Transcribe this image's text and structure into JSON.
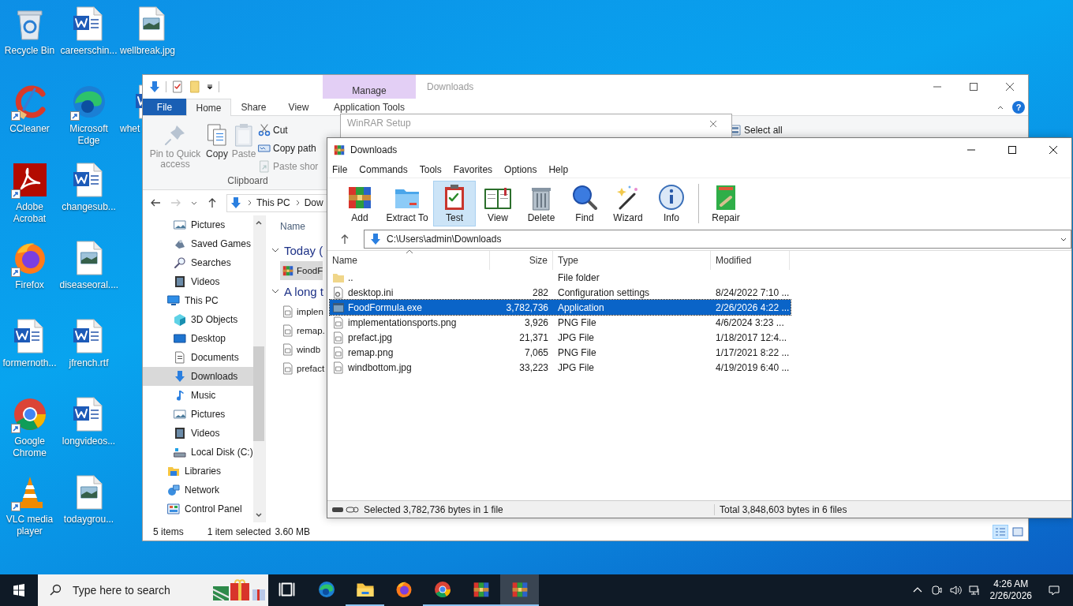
{
  "desktop_columns": [
    [
      {
        "label": "Recycle Bin",
        "kind": "recycle",
        "shortcut": false
      },
      {
        "label": "CCleaner",
        "kind": "ccleaner",
        "shortcut": true
      },
      {
        "label": "Adobe Acrobat",
        "kind": "acrobat",
        "shortcut": true
      },
      {
        "label": "Firefox",
        "kind": "firefox",
        "shortcut": true
      },
      {
        "label": "formernoth...",
        "kind": "word",
        "shortcut": false
      },
      {
        "label": "Google Chrome",
        "kind": "chrome",
        "shortcut": true
      },
      {
        "label": "VLC media player",
        "kind": "vlc",
        "shortcut": true
      }
    ],
    [
      {
        "label": "careerschin...",
        "kind": "word",
        "shortcut": false
      },
      {
        "label": "Microsoft Edge",
        "kind": "edge",
        "shortcut": true
      },
      {
        "label": "changesub...",
        "kind": "word",
        "shortcut": false
      },
      {
        "label": "diseaseoral....",
        "kind": "image",
        "shortcut": false
      },
      {
        "label": "jfrench.rtf",
        "kind": "word",
        "shortcut": false
      },
      {
        "label": "longvideos...",
        "kind": "word",
        "shortcut": false
      },
      {
        "label": "todaygrou...",
        "kind": "image",
        "shortcut": false
      }
    ],
    [
      {
        "label": "wellbreak.jpg",
        "kind": "image",
        "shortcut": false
      },
      {
        "label": "whet",
        "kind": "word",
        "shortcut": false
      }
    ]
  ],
  "explorer": {
    "title": "Downloads",
    "context_tab": "Manage",
    "help": "?",
    "tabs": [
      {
        "label": "File",
        "kind": "file",
        "selected": false
      },
      {
        "label": "Home",
        "kind": "tab",
        "selected": true
      },
      {
        "label": "Share",
        "kind": "tab",
        "selected": false
      },
      {
        "label": "View",
        "kind": "tab",
        "selected": false
      },
      {
        "label": "Application Tools",
        "kind": "tab",
        "selected": false
      }
    ],
    "ribbon": {
      "large": [
        {
          "label": "Pin to Quick access",
          "kind": "pin",
          "disabled": true
        },
        {
          "label": "Copy",
          "kind": "copy",
          "disabled": false
        },
        {
          "label": "Paste",
          "kind": "paste",
          "disabled": true
        }
      ],
      "small": [
        {
          "label": "Cut",
          "kind": "cut",
          "disabled": false
        },
        {
          "label": "Copy path",
          "kind": "copypath",
          "disabled": false
        },
        {
          "label": "Paste shor",
          "kind": "shortcut",
          "disabled": true
        }
      ],
      "group": "Clipboard",
      "select_all": "Select all"
    },
    "path": [
      "This PC",
      "Dow"
    ],
    "nav_partial": [
      {
        "label": "Pictures",
        "kind": "pictures",
        "selected": false
      },
      {
        "label": "Saved Games",
        "kind": "games",
        "selected": false
      },
      {
        "label": "Searches",
        "kind": "search",
        "selected": false
      },
      {
        "label": "Videos",
        "kind": "videos",
        "selected": false
      }
    ],
    "nav": [
      {
        "label": "This PC",
        "kind": "pc",
        "selected": false,
        "children": [
          {
            "label": "3D Objects",
            "kind": "cube",
            "selected": false
          },
          {
            "label": "Desktop",
            "kind": "desktop",
            "selected": false
          },
          {
            "label": "Documents",
            "kind": "documents",
            "selected": false
          },
          {
            "label": "Downloads",
            "kind": "downloads",
            "selected": true
          },
          {
            "label": "Music",
            "kind": "music",
            "selected": false
          },
          {
            "label": "Pictures",
            "kind": "pictures",
            "selected": false
          },
          {
            "label": "Videos",
            "kind": "videos",
            "selected": false
          },
          {
            "label": "Local Disk (C:)",
            "kind": "disk",
            "selected": false
          }
        ]
      },
      {
        "label": "Libraries",
        "kind": "libraries",
        "selected": false
      },
      {
        "label": "Network",
        "kind": "network",
        "selected": false
      },
      {
        "label": "Control Panel",
        "kind": "control",
        "selected": false
      }
    ],
    "column": "Name",
    "groups": [
      {
        "label": "Today (",
        "expanded": true,
        "files": [
          {
            "name": "FoodF",
            "kind": "rar",
            "selected": true
          }
        ]
      },
      {
        "label": "A long t",
        "expanded": true,
        "files": [
          {
            "name": "implen",
            "kind": "file",
            "selected": false
          },
          {
            "name": "remap.",
            "kind": "file",
            "selected": false
          },
          {
            "name": "windb",
            "kind": "file",
            "selected": false
          },
          {
            "name": "prefact",
            "kind": "file",
            "selected": false
          }
        ]
      }
    ],
    "status": {
      "count": "5 items",
      "selection": "1 item selected",
      "size": "3.60 MB"
    }
  },
  "setup_window": {
    "title": "WinRAR Setup"
  },
  "winrar": {
    "title": "Downloads",
    "menu": [
      "File",
      "Commands",
      "Tools",
      "Favorites",
      "Options",
      "Help"
    ],
    "tools": [
      {
        "label": "Add",
        "kind": "rar",
        "selected": false
      },
      {
        "label": "Extract To",
        "kind": "extract",
        "selected": false
      },
      {
        "label": "Test",
        "kind": "test",
        "selected": true
      },
      {
        "label": "View",
        "kind": "view",
        "selected": false
      },
      {
        "label": "Delete",
        "kind": "delete",
        "selected": false
      },
      {
        "label": "Find",
        "kind": "find",
        "selected": false
      },
      {
        "label": "Wizard",
        "kind": "wizard",
        "selected": false
      },
      {
        "label": "Info",
        "kind": "info",
        "selected": false
      },
      {
        "label": "Repair",
        "kind": "repair",
        "selected": false
      }
    ],
    "path": "C:\\Users\\admin\\Downloads",
    "columns": [
      "Name",
      "Size",
      "Type",
      "Modified"
    ],
    "rows": [
      {
        "name": "..",
        "size": "",
        "type": "File folder",
        "modified": "",
        "kind": "folder",
        "selected": false
      },
      {
        "name": "desktop.ini",
        "size": "282",
        "type": "Configuration settings",
        "modified": "8/24/2022 7:10 ...",
        "kind": "ini",
        "selected": false
      },
      {
        "name": "FoodFormula.exe",
        "size": "3,782,736",
        "type": "Application",
        "modified": "2/26/2026 4:22 ...",
        "kind": "exe",
        "selected": true
      },
      {
        "name": "implementationsports.png",
        "size": "3,926",
        "type": "PNG File",
        "modified": "4/6/2024 3:23 ...",
        "kind": "file",
        "selected": false
      },
      {
        "name": "prefact.jpg",
        "size": "21,371",
        "type": "JPG File",
        "modified": "1/18/2017 12:4...",
        "kind": "file",
        "selected": false
      },
      {
        "name": "remap.png",
        "size": "7,065",
        "type": "PNG File",
        "modified": "1/17/2021 8:22 ...",
        "kind": "file",
        "selected": false
      },
      {
        "name": "windbottom.jpg",
        "size": "33,223",
        "type": "JPG File",
        "modified": "4/19/2019 6:40 ...",
        "kind": "file",
        "selected": false
      }
    ],
    "status": [
      "Selected 3,782,736 bytes in 1 file",
      "Total 3,848,603 bytes in 6 files"
    ]
  },
  "taskbar": {
    "search_placeholder": "Type here to search",
    "apps": [
      {
        "kind": "taskview",
        "open": false,
        "active": false
      },
      {
        "kind": "edge",
        "open": false,
        "active": false
      },
      {
        "kind": "explorer",
        "open": true,
        "active": false
      },
      {
        "kind": "firefox",
        "open": false,
        "active": false
      },
      {
        "kind": "chrome",
        "open": true,
        "active": false
      },
      {
        "kind": "rar",
        "open": true,
        "active": false
      },
      {
        "kind": "rar",
        "open": true,
        "active": true
      }
    ],
    "time": "4:26 AM",
    "date": "2/26/2026"
  }
}
